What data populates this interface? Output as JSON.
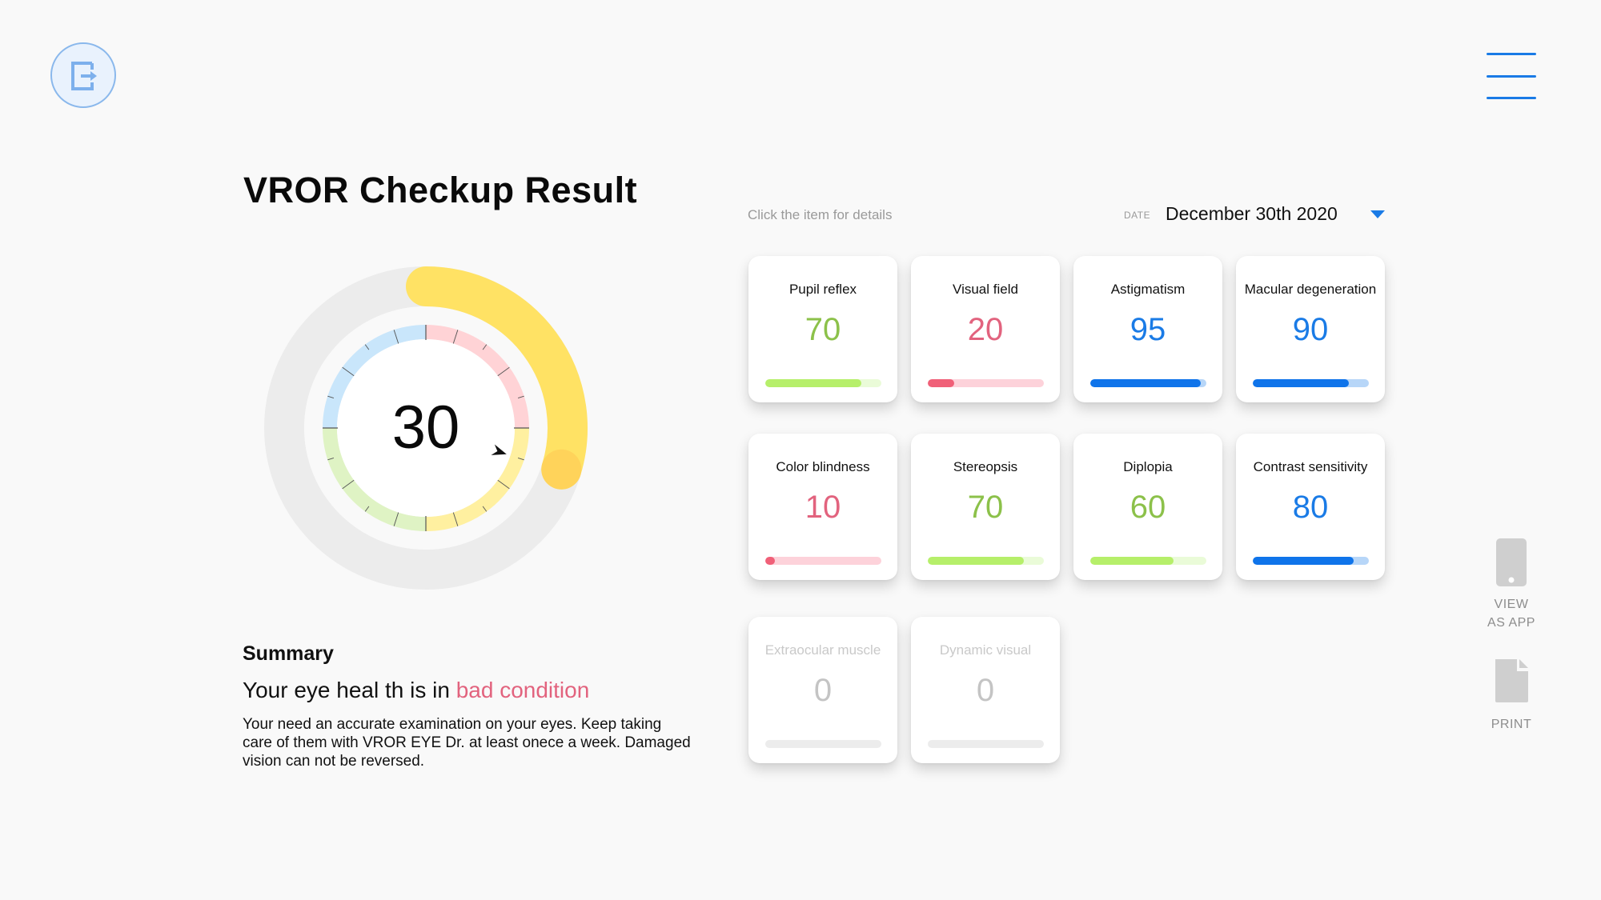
{
  "header": {
    "exit_icon": "exit-door-arrow-icon",
    "menu_icon": "hamburger-menu-icon"
  },
  "page_title": "VROR Checkup Result",
  "gauge": {
    "score": "30",
    "value_percent": 30,
    "arc_color": "#ffe264",
    "knob_color": "#ffd35a",
    "track_color": "#ececec",
    "quadrant_colors": [
      "#ffd3d6",
      "#fff0a0",
      "#dff3c4",
      "#c9e6fb"
    ]
  },
  "summary": {
    "title": "Summary",
    "headline_prefix": "Your eye heal th is in ",
    "headline_status": "bad condition",
    "status_color": "#e2637e",
    "body": "Your need an accurate examination on your eyes. Keep taking care of them with VROR EYE Dr. at least onece a week. Damaged vision can not be reversed."
  },
  "results": {
    "hint": "Click the item for details",
    "date_label": "DATE",
    "date_value": "December 30th 2020",
    "items": [
      {
        "label": "Pupil reflex",
        "value": "70",
        "fill_percent": 83,
        "color": "#8cc14a",
        "bar": "#b6ef6a",
        "track": "#eafbd8"
      },
      {
        "label": "Visual field",
        "value": "20",
        "fill_percent": 23,
        "color": "#e2637e",
        "bar": "#f06078",
        "track": "#fdd2da"
      },
      {
        "label": "Astigmatism",
        "value": "95",
        "fill_percent": 95,
        "color": "#1a7be6",
        "bar": "#0f74ea",
        "track": "#b7d6f8"
      },
      {
        "label": "Macular degeneration",
        "value": "90",
        "fill_percent": 83,
        "color": "#1a7be6",
        "bar": "#0f74ea",
        "track": "#b7d6f8"
      },
      {
        "label": "Color blindness",
        "value": "10",
        "fill_percent": 8,
        "color": "#e2637e",
        "bar": "#f06078",
        "track": "#fdd2da"
      },
      {
        "label": "Stereopsis",
        "value": "70",
        "fill_percent": 83,
        "color": "#8cc14a",
        "bar": "#b6ef6a",
        "track": "#eafbd8"
      },
      {
        "label": "Diplopia",
        "value": "60",
        "fill_percent": 72,
        "color": "#8cc14a",
        "bar": "#b6ef6a",
        "track": "#eafbd8"
      },
      {
        "label": "Contrast sensitivity",
        "value": "80",
        "fill_percent": 87,
        "color": "#1a7be6",
        "bar": "#0f74ea",
        "track": "#b7d6f8"
      },
      {
        "label": "Extraocular muscle",
        "value": "0",
        "fill_percent": 0,
        "disabled": true,
        "color": "#c4c4c4",
        "bar": "#ececec",
        "track": "#ececec"
      },
      {
        "label": "Dynamic visual",
        "value": "0",
        "fill_percent": 0,
        "disabled": true,
        "color": "#c4c4c4",
        "bar": "#ececec",
        "track": "#ececec"
      }
    ]
  },
  "side_actions": {
    "view_app_line1": "VIEW",
    "view_app_line2": "AS APP",
    "view_app_icon": "phone-icon",
    "print_label": "PRINT",
    "print_icon": "document-icon"
  }
}
